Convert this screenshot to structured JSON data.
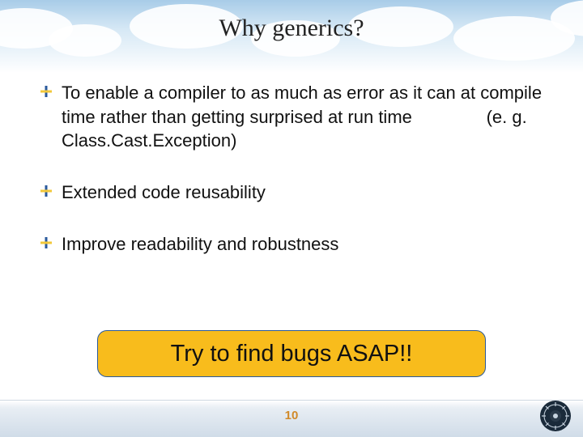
{
  "title": "Why generics?",
  "bullets": [
    "To enable a compiler to as much as error as it can at compile time rather than getting surprised at run time               (e. g. Class.Cast.Exception)",
    "Extended code reusability",
    "Improve readability and robustness"
  ],
  "callout": "Try to find bugs ASAP!!",
  "page_number": "10",
  "colors": {
    "bullet_yellow": "#f2c83a",
    "bullet_blue": "#2a5a9c",
    "callout_bg": "#f8bc1c",
    "callout_border": "#2a5a9c"
  }
}
